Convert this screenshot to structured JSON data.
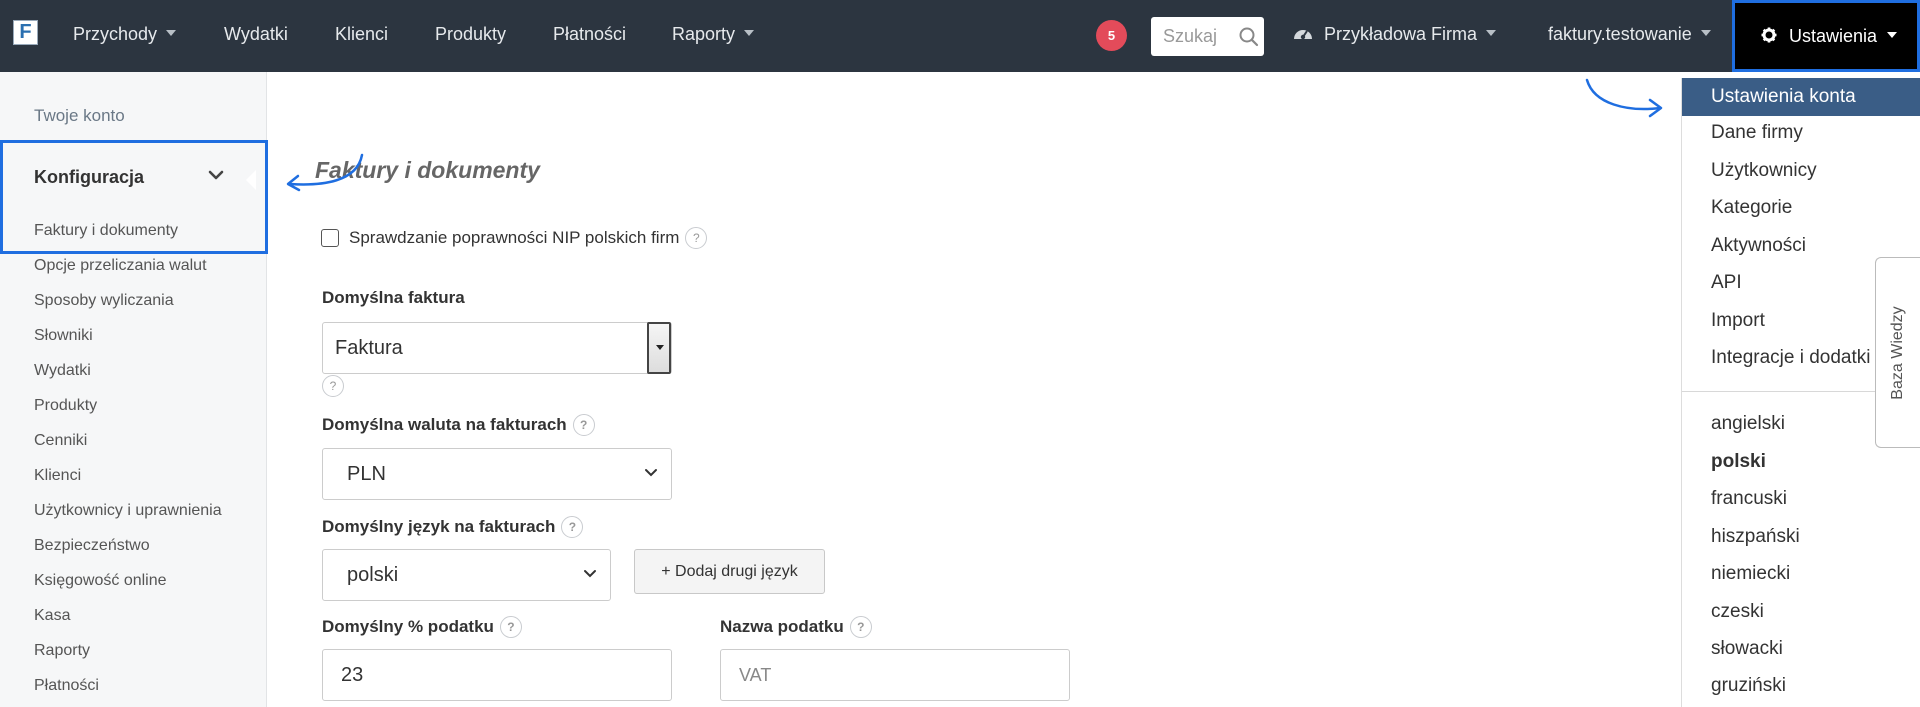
{
  "app": {
    "logo_letter": "F"
  },
  "nav": {
    "items": [
      {
        "label": "Przychody",
        "caret": true
      },
      {
        "label": "Wydatki",
        "caret": false
      },
      {
        "label": "Klienci",
        "caret": false
      },
      {
        "label": "Produkty",
        "caret": false
      },
      {
        "label": "Płatności",
        "caret": false
      },
      {
        "label": "Raporty",
        "caret": true
      }
    ],
    "notifications_count": "5",
    "search_placeholder": "Szukaj",
    "company": "Przykładowa Firma",
    "account": "faktury.testowanie",
    "settings_label": "Ustawienia"
  },
  "sidebar": {
    "account_link": "Twoje konto",
    "section_title": "Konfiguracja",
    "items": [
      "Faktury i dokumenty",
      "Opcje przeliczania walut",
      "Sposoby wyliczania",
      "Słowniki",
      "Wydatki",
      "Produkty",
      "Cenniki",
      "Klienci",
      "Użytkownicy i uprawnienia",
      "Bezpieczeństwo",
      "Księgowość online",
      "Kasa",
      "Raporty",
      "Płatności"
    ]
  },
  "main": {
    "title": "Faktury i dokumenty",
    "nip_check_label": "Sprawdzanie poprawności NIP polskich firm",
    "default_invoice_label": "Domyślna faktura",
    "default_invoice_value": "Faktura",
    "default_currency_label": "Domyślna waluta na fakturach",
    "default_currency_value": "PLN",
    "default_language_label": "Domyślny język na fakturach",
    "default_language_value": "polski",
    "add_language_button": "+ Dodaj drugi język",
    "default_tax_label": "Domyślny % podatku",
    "default_tax_value": "23",
    "tax_name_label": "Nazwa podatku",
    "tax_name_placeholder": "VAT",
    "help_glyph": "?"
  },
  "settings_menu": {
    "active": "Ustawienia konta",
    "items": [
      "Dane firmy",
      "Użytkownicy",
      "Kategorie",
      "Aktywności",
      "API",
      "Import",
      "Integracje i dodatki"
    ],
    "languages": [
      "angielski",
      "polski",
      "francuski",
      "hiszpański",
      "niemiecki",
      "czeski",
      "słowacki",
      "gruziński"
    ],
    "selected_language": "polski"
  },
  "knowledge_base_tab": "Baza Wiedzy",
  "colors": {
    "navbar": "#2c3540",
    "highlight": "#1f6ee0",
    "menu_active": "#3a5d86",
    "badge": "#e34b5a"
  }
}
